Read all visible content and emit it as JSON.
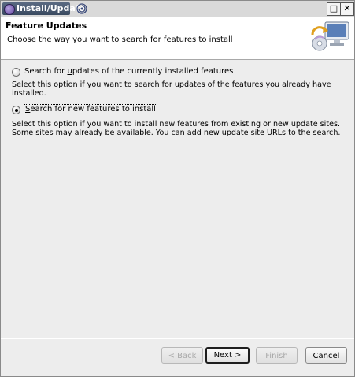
{
  "window": {
    "title": "Install/Update",
    "controls": {
      "minimize": "□",
      "close": "✕"
    }
  },
  "banner": {
    "title": "Feature Updates",
    "subtitle": "Choose the way you want to search for features to install"
  },
  "options": [
    {
      "label_pre": "Search for ",
      "label_mnemonic": "u",
      "label_post": "pdates of the currently installed features",
      "selected": false,
      "description": "Select this option if you want to search for updates of the features you already have installed."
    },
    {
      "label_pre": "",
      "label_mnemonic": "S",
      "label_post": "earch for new features to install",
      "selected": true,
      "description": "Select this option if you want to install new features from existing or new update sites. Some sites may already be available. You can add new update site URLs to the search."
    }
  ],
  "buttons": {
    "back": "< Back",
    "next": "Next >",
    "finish": "Finish",
    "cancel": "Cancel"
  },
  "button_state": {
    "back": "disabled",
    "next": "default",
    "finish": "disabled",
    "cancel": "enabled"
  },
  "icons": {
    "app": "eclipse-icon",
    "taskbar": "swirl-icon",
    "banner": "update-computer-icon"
  }
}
